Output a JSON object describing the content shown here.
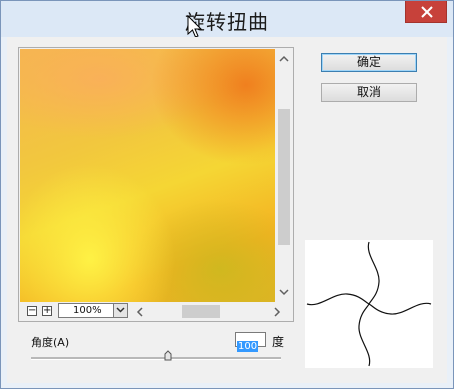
{
  "window": {
    "title": "旋转扭曲"
  },
  "buttons": {
    "ok": "确定",
    "cancel": "取消"
  },
  "preview": {
    "zoom_out": "−",
    "zoom_in": "+",
    "zoom_value": "100%"
  },
  "controls": {
    "angle_label": "角度(A)",
    "angle_value": "100",
    "angle_unit": "度"
  }
}
